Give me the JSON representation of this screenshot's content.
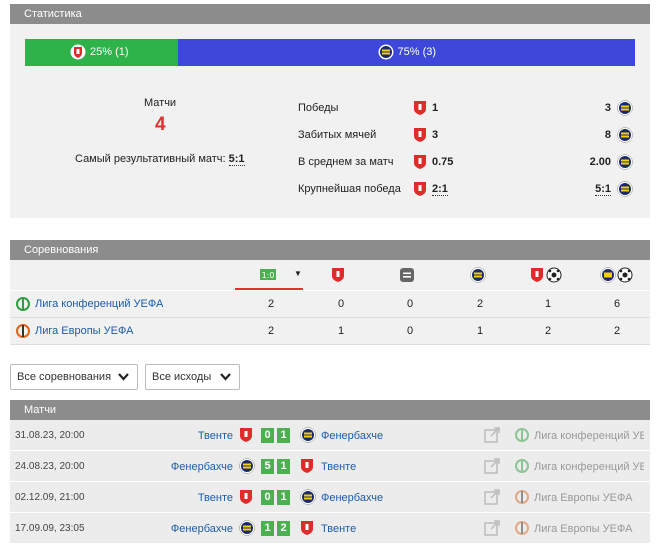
{
  "stats": {
    "header": "Статистика",
    "bar_left": "25% (1)",
    "bar_right": "75% (3)",
    "bar_left_share": 0.25,
    "matches_label": "Матчи",
    "matches_count": "4",
    "top_scoring_label": "Самый результативный матч:",
    "top_scoring_value": "5:1",
    "rows": [
      {
        "label": "Победы",
        "left": "1",
        "right": "3"
      },
      {
        "label": "Забитых мячей",
        "left": "3",
        "right": "8"
      },
      {
        "label": "В среднем за матч",
        "left": "0.75",
        "right": "2.00"
      },
      {
        "label": "Крупнейшая победа",
        "left": "2:1",
        "right": "5:1"
      }
    ]
  },
  "competitions": {
    "header": "Соревнования",
    "rows": [
      {
        "name": "Лига конференций УЕФА",
        "total": "2",
        "twente_wins": "0",
        "draws": "0",
        "fener_wins": "2",
        "twente_goals": "1",
        "fener_goals": "6"
      },
      {
        "name": "Лига Европы УЕФА",
        "total": "2",
        "twente_wins": "1",
        "draws": "0",
        "fener_wins": "1",
        "twente_goals": "2",
        "fener_goals": "2"
      }
    ]
  },
  "filters": {
    "competition": "Все соревнования",
    "outcome": "Все исходы"
  },
  "matches": {
    "header": "Матчи",
    "rows": [
      {
        "date": "31.08.23, 20:00",
        "home": "Твенте",
        "home_score": "0",
        "away_score": "1",
        "away": "Фенербахче",
        "competition": "Лига конференций УЕФА",
        "home_is_twente": true,
        "comp": "conf"
      },
      {
        "date": "24.08.23, 20:00",
        "home": "Фенербахче",
        "home_score": "5",
        "away_score": "1",
        "away": "Твенте",
        "competition": "Лига конференций УЕФА",
        "home_is_twente": false,
        "comp": "conf"
      },
      {
        "date": "02.12.09, 21:00",
        "home": "Твенте",
        "home_score": "0",
        "away_score": "1",
        "away": "Фенербахче",
        "competition": "Лига Европы УЕФА",
        "home_is_twente": true,
        "comp": "europa"
      },
      {
        "date": "17.09.09, 23:05",
        "home": "Фенербахче",
        "home_score": "1",
        "away_score": "2",
        "away": "Твенте",
        "competition": "Лига Европы УЕФА",
        "home_is_twente": false,
        "comp": "europa"
      }
    ]
  },
  "colors": {
    "twente_bar": "#2db34a",
    "fener_bar": "#3d47d9",
    "score_green": "#4caf50",
    "header_grey": "#8c8c8c",
    "highlight_red": "#e03030"
  }
}
